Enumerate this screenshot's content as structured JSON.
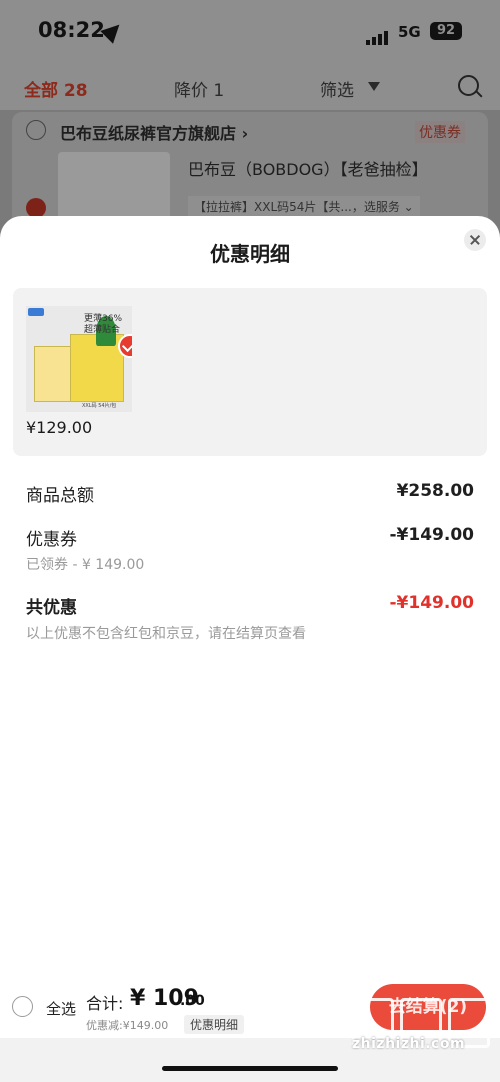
{
  "status_bar": {
    "time": "08:22",
    "network": "5G",
    "battery": "92"
  },
  "top_nav": {
    "all_tab": "全部 28",
    "price_drop_tab": "降价 1",
    "filter_tab": "筛选"
  },
  "shop": {
    "name": "巴布豆纸尿裤官方旗舰店 ›",
    "coupon_tag": "优惠券",
    "product_title": "巴布豆（BOBDOG）【老爸抽检】",
    "product_spec": "【拉拉裤】XXL码54片【共...，选服务 ⌄"
  },
  "sheet": {
    "title": "优惠明细",
    "item": {
      "price": "¥129.00",
      "thumb_text": "更薄36%\n超薄贴合",
      "thumb_label": "XXL码 54片/包"
    },
    "rows": {
      "subtotal_label": "商品总额",
      "subtotal_value": "¥258.00",
      "coupon_label": "优惠券",
      "coupon_value": "-¥149.00",
      "coupon_sub": "已领券 - ¥ 149.00",
      "total_discount_label": "共优惠",
      "total_discount_value": "-¥149.00",
      "note": "以上优惠不包含红包和京豆，请在结算页查看"
    }
  },
  "bottom_bar": {
    "select_all": "全选",
    "total_label": "合计:",
    "total_int": "¥ 109",
    "total_dec": ".00",
    "discount_line": "优惠减:¥149.00",
    "detail_pill": "优惠明细",
    "checkout": "去结算(2)"
  },
  "watermark": {
    "text": "zhizhizhi.com"
  },
  "colors": {
    "accent_red": "#e2312a",
    "checkout_button": "#ea4b3b"
  }
}
